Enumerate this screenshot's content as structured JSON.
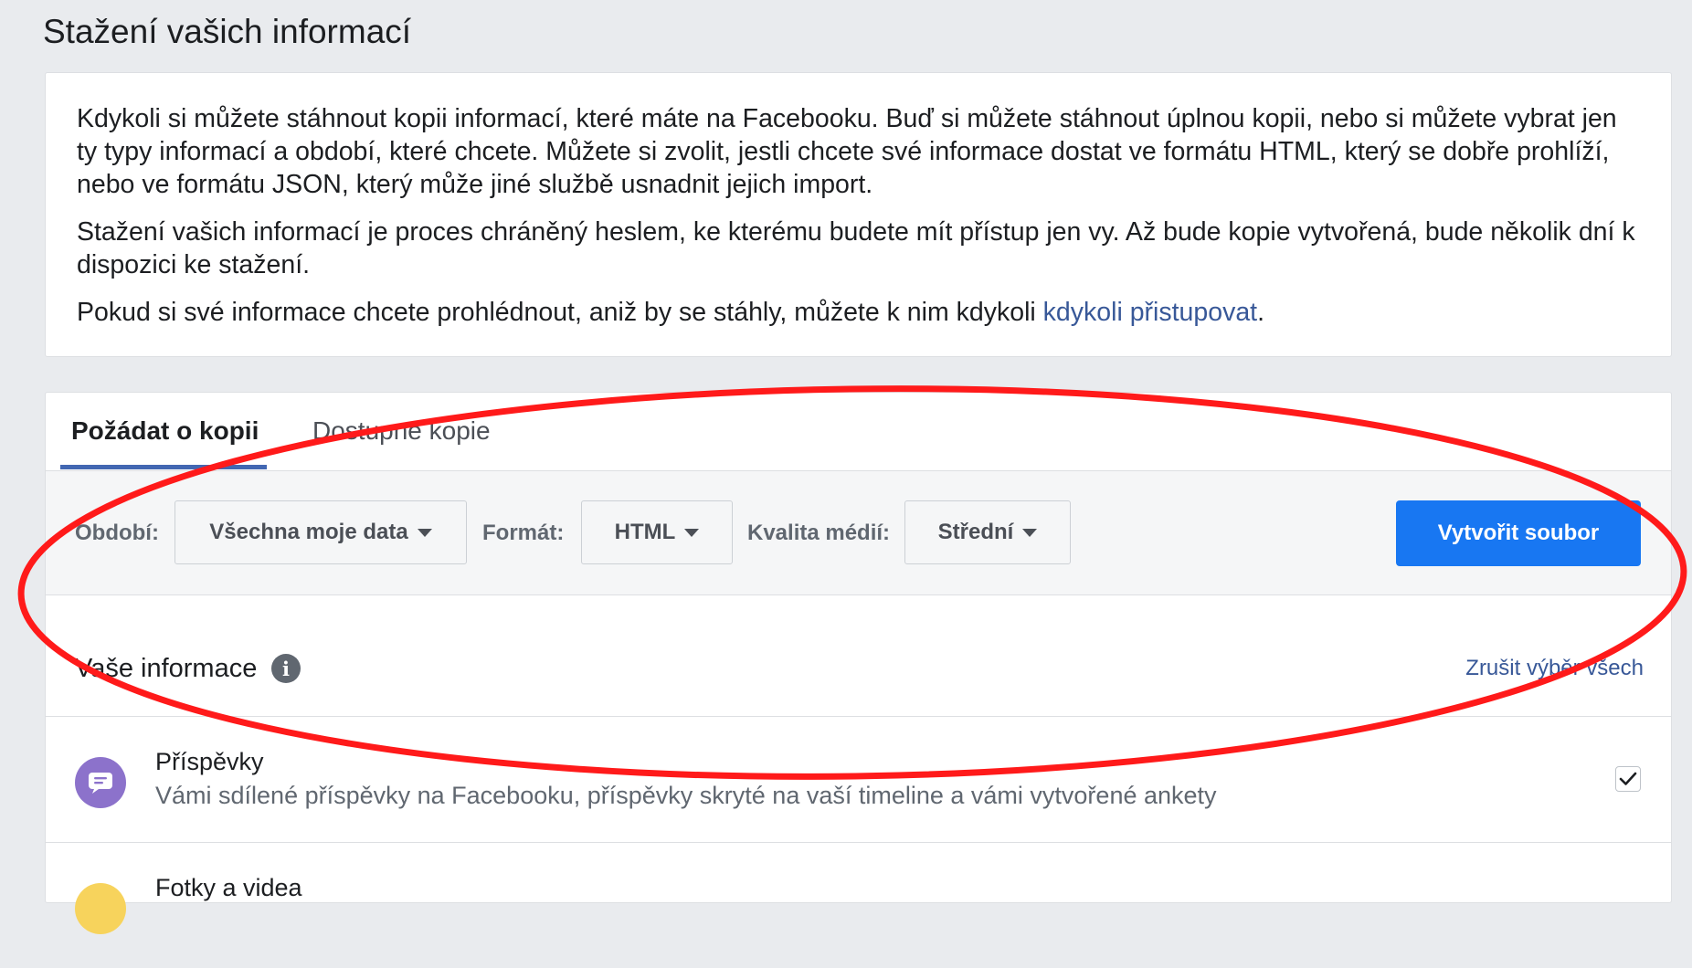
{
  "page": {
    "title": "Stažení vašich informací"
  },
  "intro": {
    "paragraph1": "Kdykoli si můžete stáhnout kopii informací, které máte na Facebooku. Buď si můžete stáhnout úplnou kopii, nebo si můžete vybrat jen ty typy informací a období, které chcete. Můžete si zvolit, jestli chcete své informace dostat ve formátu HTML, který se dobře prohlíží, nebo ve formátu JSON, který může jiné službě usnadnit jejich import.",
    "paragraph2": "Stažení vašich informací je proces chráněný heslem, ke kterému budete mít přístup jen vy. Až bude kopie vytvořená, bude několik dní k dispozici ke stažení.",
    "paragraph3_prefix": "Pokud si své informace chcete prohlédnout, aniž by se stáhly, můžete k nim kdykoli ",
    "paragraph3_link": "kdykoli přistupovat",
    "paragraph3_suffix": "."
  },
  "tabs": [
    {
      "label": "Požádat o kopii",
      "active": true
    },
    {
      "label": "Dostupné kopie",
      "active": false
    }
  ],
  "options": {
    "period_label": "Období:",
    "period_value": "Všechna moje data",
    "format_label": "Formát:",
    "format_value": "HTML",
    "quality_label": "Kvalita médií:",
    "quality_value": "Střední",
    "create_button": "Vytvořit soubor"
  },
  "info_section": {
    "title": "Vaše informace",
    "info_icon": "info-icon",
    "deselect_all": "Zrušit výběr všech"
  },
  "categories": [
    {
      "title": "Příspěvky",
      "description": "Vámi sdílené příspěvky na Facebooku, příspěvky skryté na vaší timeline a vámi vytvořené ankety",
      "icon": "posts-icon",
      "icon_color": "#8c72cb",
      "checked": true
    },
    {
      "title": "Fotky a videa",
      "icon": "photos-icon",
      "icon_color": "#f7d35c"
    }
  ],
  "colors": {
    "accent": "#1877f2",
    "link": "#385898",
    "tab_underline": "#4267b2",
    "annotation": "#ff1a1a"
  }
}
